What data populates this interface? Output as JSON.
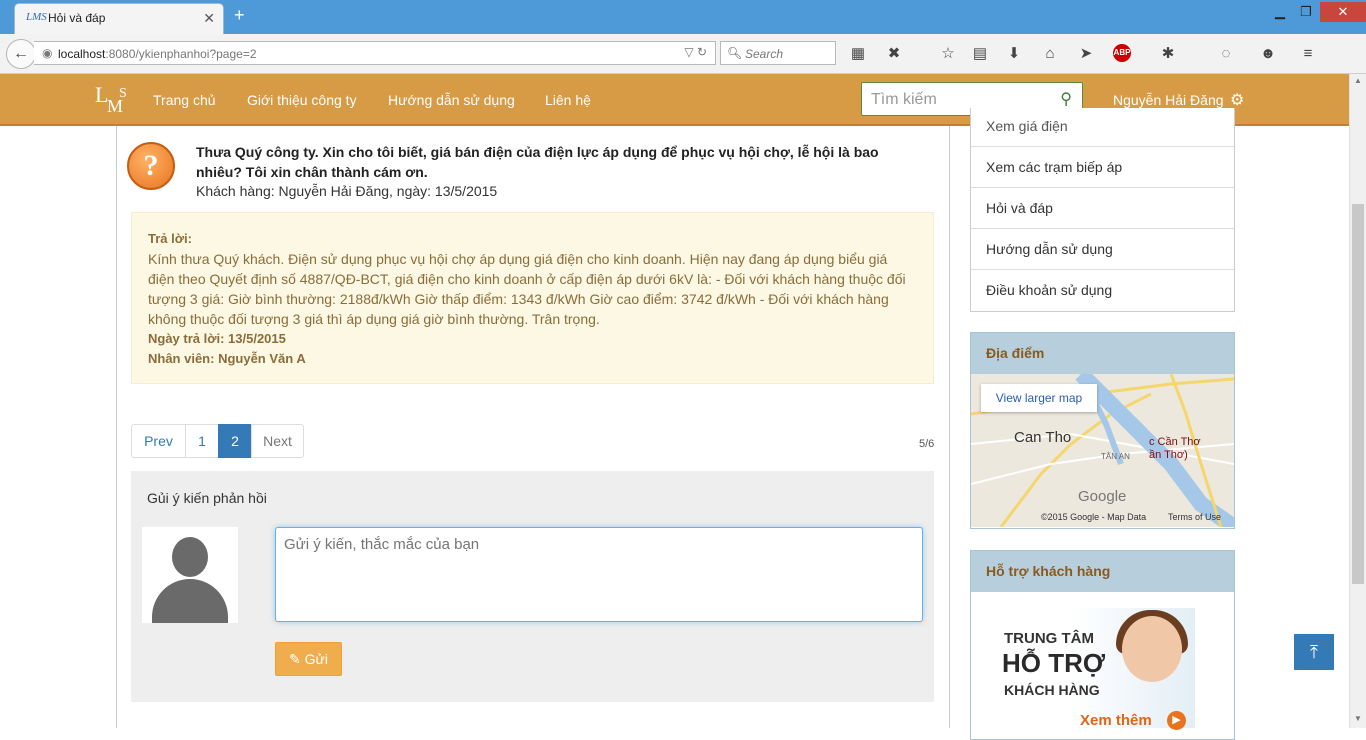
{
  "browser": {
    "tab_title": "Hỏi và đáp",
    "tab_icon": "lms-favicon",
    "url_host": "localhost",
    "url_rest": ":8080/ykienphanhoi?page=2",
    "search_placeholder": "Search",
    "abp_label": "ABP",
    "accent": "#4e9ad8"
  },
  "header": {
    "logo": {
      "l": "L",
      "m": "M",
      "s": "S"
    },
    "menu": [
      "Trang chủ",
      "Giới thiệu công ty",
      "Hướng dẫn sử dụng",
      "Liên hệ"
    ],
    "search_placeholder": "Tìm kiếm",
    "user_name": "Nguyễn Hải Đăng",
    "color": "#d79b45"
  },
  "question": {
    "text": "Thưa Quý công ty. Xin cho tôi biết, giá bán điện của điện lực áp dụng để phục vụ hội chợ, lễ hội là bao nhiêu? Tôi xin chân thành cám ơn.",
    "meta": "Khách hàng: Nguyễn Hải Đăng, ngày: 13/5/2015"
  },
  "answer": {
    "label": "Trả lời:",
    "body": "Kính thưa Quý khách. Điện sử dụng phục vụ hội chợ áp dụng giá điện cho kinh doanh. Hiện nay đang áp dụng biểu giá điện theo Quyết định số 4887/QĐ-BCT, giá điện cho kinh doanh ở cấp điện áp dưới 6kV là: - Đối với khách hàng thuộc đối tượng 3 giá: Giờ bình thường: 2188đ/kWh Giờ thấp điểm: 1343 đ/kWh Giờ cao điểm: 3742 đ/kWh - Đối với khách hàng không thuộc đối tượng 3 giá thì áp dụng giá giờ bình thường. Trân trọng.",
    "date": "Ngày trả lời: 13/5/2015",
    "staff": "Nhân viên: Nguyễn Văn A"
  },
  "pagination": {
    "prev": "Prev",
    "pages": [
      "1",
      "2"
    ],
    "current": "2",
    "next": "Next",
    "count": "5/6"
  },
  "feedback": {
    "title": "Gủi ý kiến phản hồi",
    "placeholder": "Gửi ý kiến, thắc mắc của bạn",
    "send_label": "Gửi"
  },
  "sidebar": {
    "items": [
      "Xem giá điện",
      "Xem các trạm biếp áp",
      "Hỏi và đáp",
      "Hướng dẫn sử dụng",
      "Điều khoản sử dụng"
    ],
    "location_title": "Địa điểm",
    "map": {
      "button": "View larger map",
      "city": "Can Tho",
      "city2_line1": "c Cần Thơ",
      "city2_line2": "ần Thơ)",
      "district": "TÂN AN",
      "brand": "Google",
      "credit": "©2015 Google - Map Data",
      "terms": "Terms of Use"
    },
    "support_title": "Hỗ trợ khách hàng",
    "support": {
      "line1": "TRUNG TÂM",
      "line2": "HỖ TRỢ",
      "line3": "KHÁCH HÀNG",
      "more": "Xem thêm"
    }
  }
}
